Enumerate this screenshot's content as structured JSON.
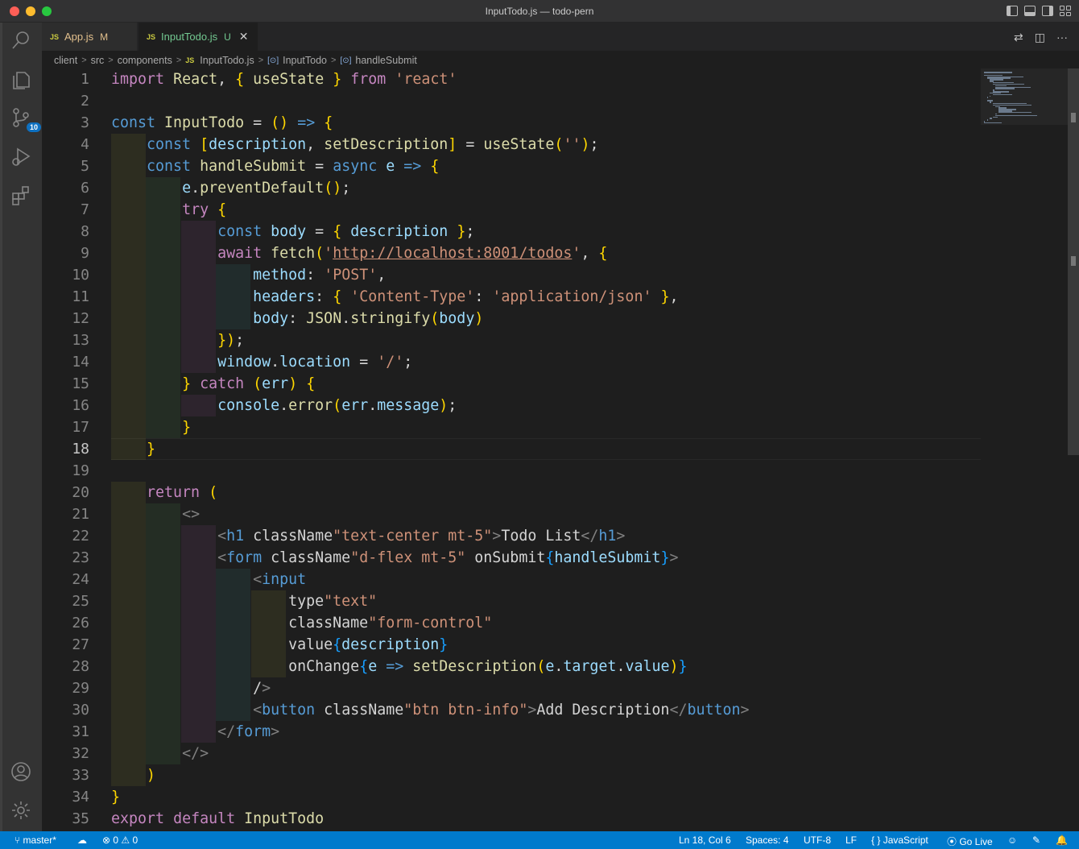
{
  "window": {
    "title": "InputTodo.js — todo-pern"
  },
  "activity": {
    "scm_badge": "10"
  },
  "tabs": [
    {
      "label": "App.js",
      "status": "M",
      "badge": "JS"
    },
    {
      "label": "InputTodo.js",
      "status": "U",
      "badge": "JS"
    }
  ],
  "breadcrumb": {
    "parts": [
      "client",
      "src",
      "components",
      "InputTodo.js",
      "InputTodo",
      "handleSubmit"
    ]
  },
  "editor": {
    "current_line": 18,
    "line_numbers": [
      "1",
      "2",
      "3",
      "4",
      "5",
      "6",
      "7",
      "8",
      "9",
      "10",
      "11",
      "12",
      "13",
      "14",
      "15",
      "16",
      "17",
      "18",
      "19",
      "20",
      "21",
      "22",
      "23",
      "24",
      "25",
      "26",
      "27",
      "28",
      "29",
      "30",
      "31",
      "32",
      "33",
      "34",
      "35"
    ],
    "lines": [
      "import React, { useState } from 'react'",
      "",
      "const InputTodo = () => {",
      "    const [description, setDescription] = useState('');",
      "    const handleSubmit = async e => {",
      "        e.preventDefault();",
      "        try {",
      "            const body = { description };",
      "            await fetch('http://localhost:8001/todos', {",
      "                method: 'POST',",
      "                headers: { 'Content-Type': 'application/json' },",
      "                body: JSON.stringify(body)",
      "            });",
      "            window.location = '/';",
      "        } catch (err) {",
      "            console.error(err.message);",
      "        }",
      "    }",
      "",
      "    return (",
      "        <>",
      "            <h1 className=\"text-center mt-5\">Todo List</h1>",
      "            <form className=\"d-flex mt-5\" onSubmit={handleSubmit}>",
      "                <input",
      "                    type=\"text\"",
      "                    className=\"form-control\"",
      "                    value={description}",
      "                    onChange={e => setDescription(e.target.value)}",
      "                />",
      "                <button className=\"btn btn-info\">Add Description</button>",
      "            </form>",
      "        </>",
      "    )",
      "}",
      "export default InputTodo"
    ]
  },
  "status": {
    "branch": "master*",
    "errors": "0",
    "warnings": "0",
    "position": "Ln 18, Col 6",
    "spaces": "Spaces: 4",
    "encoding": "UTF-8",
    "eol": "LF",
    "language": "JavaScript",
    "golive": "Go Live"
  }
}
